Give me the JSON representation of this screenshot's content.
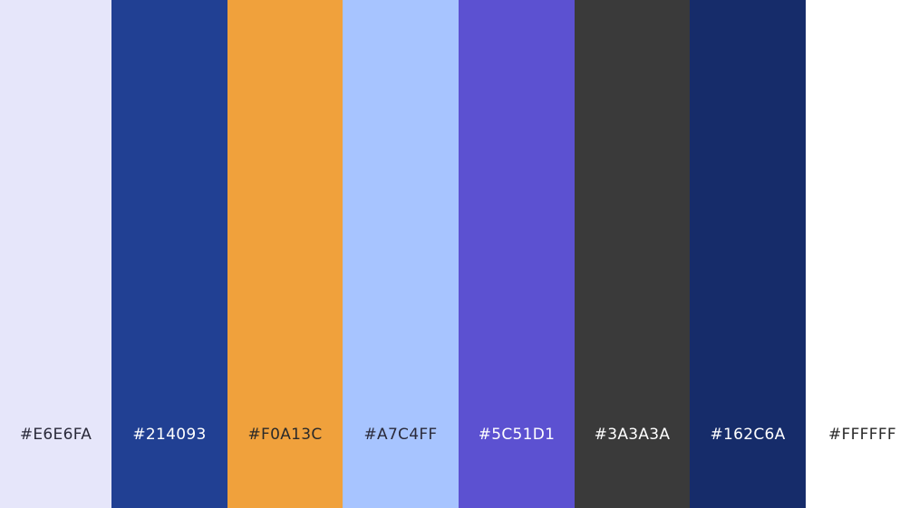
{
  "swatches": [
    {
      "hex": "#E6E6FA",
      "label": "#E6E6FA",
      "text_color": "#2A2A3A"
    },
    {
      "hex": "#214093",
      "label": "#214093",
      "text_color": "#FFFFFF"
    },
    {
      "hex": "#F0A13C",
      "label": "#F0A13C",
      "text_color": "#2A2A2A"
    },
    {
      "hex": "#A7C4FF",
      "label": "#A7C4FF",
      "text_color": "#2A2A3A"
    },
    {
      "hex": "#5C51D1",
      "label": "#5C51D1",
      "text_color": "#FFFFFF"
    },
    {
      "hex": "#3A3A3A",
      "label": "#3A3A3A",
      "text_color": "#FFFFFF"
    },
    {
      "hex": "#162C6A",
      "label": "#162C6A",
      "text_color": "#FFFFFF"
    },
    {
      "hex": "#FFFFFF",
      "label": "#FFFFFF",
      "text_color": "#2A2A2A"
    }
  ]
}
